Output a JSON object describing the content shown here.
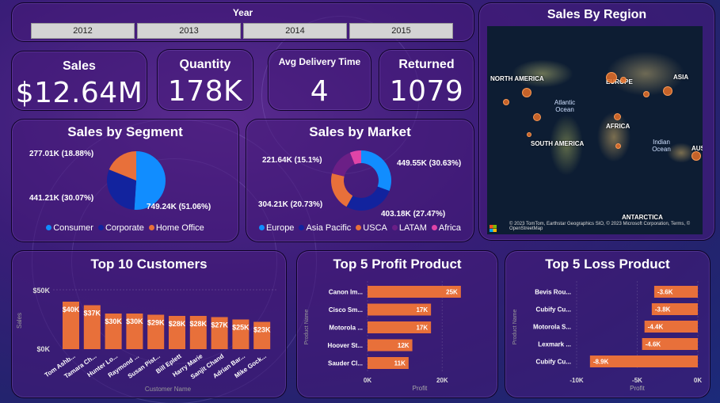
{
  "filter": {
    "title": "Year",
    "years": [
      "2012",
      "2013",
      "2014",
      "2015"
    ]
  },
  "kpis": [
    {
      "label": "Sales",
      "value": "$12.64M"
    },
    {
      "label": "Quantity",
      "value": "178K"
    },
    {
      "label": "Avg Delivery Time",
      "value": "4"
    },
    {
      "label": "Returned",
      "value": "1079"
    }
  ],
  "map": {
    "title": "Sales By Region",
    "labels": [
      "NORTH AMERICA",
      "EUROPE",
      "ASIA",
      "AFRICA",
      "SOUTH AMERICA",
      "AUSTR",
      "ANTARCTICA"
    ],
    "oceans": [
      "Atlantic Ocean",
      "Indian Ocean"
    ],
    "credit": "© 2023 TomTom, Earthstar Geographics SIO, © 2023 Microsoft Corporation, Terms, © OpenStreetMap",
    "bubble_color": "#e8702a"
  },
  "colors": {
    "orange": "#e8703a",
    "blue": "#118dff",
    "navy": "#1c2fa8",
    "purple": "#6b1f86",
    "pink": "#e044a7",
    "teal": "#12239e"
  },
  "chart_data": [
    {
      "type": "pie",
      "title": "Sales by Segment",
      "slices": [
        {
          "name": "Consumer",
          "value": 749.24,
          "label": "749.24K (51.06%)",
          "color": "#118dff"
        },
        {
          "name": "Corporate",
          "value": 441.21,
          "label": "441.21K (30.07%)",
          "color": "#12239e"
        },
        {
          "name": "Home Office",
          "value": 277.01,
          "label": "277.01K (18.88%)",
          "color": "#e8703a"
        }
      ]
    },
    {
      "type": "pie",
      "donut": true,
      "title": "Sales by Market",
      "slices": [
        {
          "name": "Europe",
          "value": 449.55,
          "label": "449.55K (30.63%)",
          "color": "#118dff"
        },
        {
          "name": "Asia Pacific",
          "value": 403.18,
          "label": "403.18K (27.47%)",
          "color": "#12239e"
        },
        {
          "name": "USCA",
          "value": 304.21,
          "label": "304.21K (20.73%)",
          "color": "#e8703a"
        },
        {
          "name": "LATAM",
          "value": 221.64,
          "label": "221.64K (15.1%)",
          "color": "#6b1f86"
        },
        {
          "name": "Africa",
          "value": 89.1,
          "label": "",
          "color": "#e044a7"
        }
      ]
    },
    {
      "type": "bar",
      "title": "Top 10 Customers",
      "xlabel": "Customer Name",
      "ylabel": "Sales",
      "categories": [
        "Tom Ashb...",
        "Tamara Ch...",
        "Hunter Lo...",
        "Raymond ...",
        "Susan Pist...",
        "Bill Eplett",
        "Harry Marie",
        "Sanjit Chand",
        "Adrian Bar...",
        "Mike Gock..."
      ],
      "values": [
        40,
        37,
        30,
        30,
        29,
        28,
        28,
        27,
        25,
        23
      ],
      "value_labels": [
        "$40K",
        "$37K",
        "$30K",
        "$30K",
        "$29K",
        "$28K",
        "$28K",
        "$27K",
        "$25K",
        "$23K"
      ],
      "yticks": [
        "$0K",
        "$50K"
      ],
      "ylim": [
        0,
        50
      ]
    },
    {
      "type": "bar",
      "orientation": "horizontal",
      "title": "Top 5 Profit Product",
      "xlabel": "Profit",
      "ylabel": "Product Name",
      "categories": [
        "Canon Im...",
        "Cisco Sm...",
        "Motorola ...",
        "Hoover St...",
        "Sauder Cl..."
      ],
      "values": [
        25,
        17,
        17,
        12,
        11
      ],
      "value_labels": [
        "25K",
        "17K",
        "17K",
        "12K",
        "11K"
      ],
      "xticks": [
        "0K",
        "20K"
      ],
      "xlim": [
        0,
        28
      ]
    },
    {
      "type": "bar",
      "orientation": "horizontal",
      "title": "Top 5 Loss Product",
      "xlabel": "Profit",
      "ylabel": "Product Name",
      "categories": [
        "Bevis Rou...",
        "Cubify Cu...",
        "Motorola S...",
        "Lexmark ...",
        "Cubify Cu..."
      ],
      "values": [
        -3.6,
        -3.8,
        -4.4,
        -4.6,
        -8.9
      ],
      "value_labels": [
        "-3.6K",
        "-3.8K",
        "-4.4K",
        "-4.6K",
        "-8.9K"
      ],
      "xticks": [
        "-10K",
        "-5K",
        "0K"
      ],
      "xlim": [
        -10,
        0
      ]
    }
  ]
}
